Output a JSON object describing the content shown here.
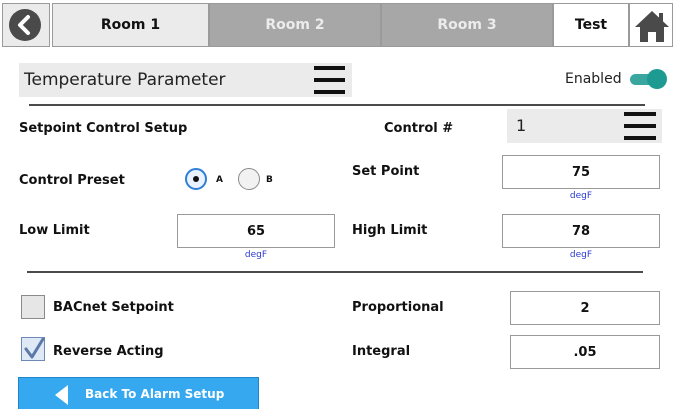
{
  "tabs": [
    {
      "label": "Room 1",
      "state": "active"
    },
    {
      "label": "Room 2",
      "state": "inactive"
    },
    {
      "label": "Room 3",
      "state": "inactive"
    },
    {
      "label": "Test",
      "state": "light"
    }
  ],
  "parameter": {
    "selected": "Temperature Parameter",
    "enabled_label": "Enabled",
    "enabled": true
  },
  "setpoint": {
    "section_title": "Setpoint Control Setup",
    "control_label": "Control #",
    "control_value": "1",
    "preset_label": "Control Preset",
    "preset_options": [
      "A",
      "B"
    ],
    "preset_selected": "A",
    "set_point_label": "Set Point",
    "set_point_value": "75",
    "set_point_unit": "degF",
    "low_limit_label": "Low Limit",
    "low_limit_value": "65",
    "low_limit_unit": "degF",
    "high_limit_label": "High Limit",
    "high_limit_value": "78",
    "high_limit_unit": "degF"
  },
  "options": {
    "bacnet_label": "BACnet Setpoint",
    "bacnet_checked": false,
    "reverse_label": "Reverse Acting",
    "reverse_checked": true,
    "proportional_label": "Proportional",
    "proportional_value": "2",
    "integral_label": "Integral",
    "integral_value": ".05"
  },
  "footer": {
    "back_button_label": "Back To Alarm Setup"
  },
  "colors": {
    "toggle_on": "#1d9a92",
    "button_blue": "#35a8f0",
    "unit_text": "#2c39d4",
    "radio_selected": "#2f7fd8"
  },
  "icons": {
    "back": "chevron-left-circle",
    "home": "house",
    "menu": "hamburger",
    "check": "checkmark",
    "back_arrow": "triangle-left"
  }
}
